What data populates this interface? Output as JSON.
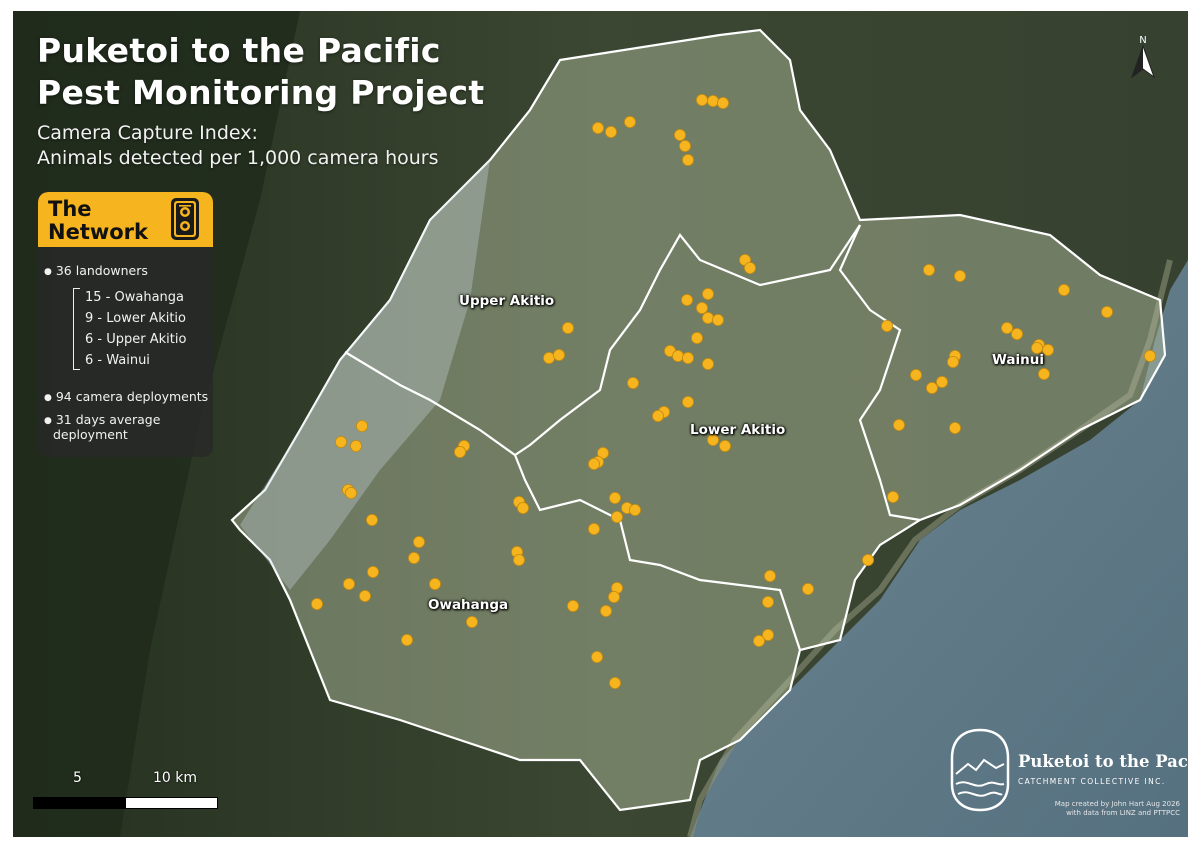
{
  "map": {
    "title_line1": "Puketoi to the Pacific",
    "title_line2": "Pest Monitoring Project",
    "subtitle_line1": "Camera Capture Index:",
    "subtitle_line2": "Animals detected per 1,000 camera hours",
    "colors": {
      "camera_marker": "#f6b51e",
      "legend_header": "#f6b51e",
      "boundary": "#ffffff",
      "sea": "#5e7583",
      "land_dark": "#2c3a28"
    }
  },
  "legend": {
    "title_line1": "The",
    "title_line2": "Network",
    "icon": "trail-camera-icon",
    "landowners": "36 landowners",
    "breakdown": [
      "15 - Owahanga",
      "9 - Lower Akitio",
      "6 - Upper Akitio",
      "6 - Wainui"
    ],
    "deployments": "94 camera deployments",
    "average_line1": "31 days average",
    "average_line2": "deployment"
  },
  "regions": {
    "upper_akitio": "Upper Akitio",
    "lower_akitio": "Lower Akitio",
    "wainui": "Wainui",
    "owahanga": "Owahanga"
  },
  "scale": {
    "label_5": "5",
    "label_10": "10 km"
  },
  "north": {
    "label": "N",
    "icon": "north-arrow-icon"
  },
  "organisation": {
    "name": "Puketoi to the Pacific",
    "subname": "CATCHMENT COLLECTIVE INC.",
    "icon": "catchment-collective-logo",
    "credit_line1": "Map created by John Hart Aug 2026",
    "credit_line2": "with data from LINZ and PTTPCC"
  }
}
